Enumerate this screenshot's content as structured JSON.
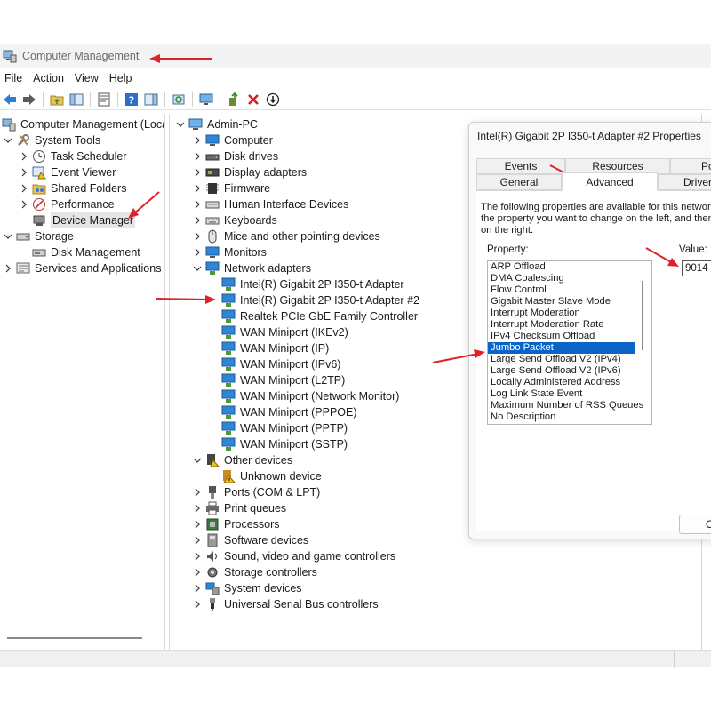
{
  "window": {
    "title": "Computer Management"
  },
  "menu": {
    "file": "File",
    "action": "Action",
    "view": "View",
    "help": "Help"
  },
  "toolbar": {
    "buttons": [
      "back-icon",
      "forward-icon",
      "up-folder-icon",
      "show-hide-tree-icon",
      "properties-icon",
      "help-icon",
      "action-pane-icon",
      "refresh-icon",
      "monitor-icon",
      "update-driver-icon",
      "uninstall-icon",
      "disable-icon"
    ]
  },
  "left_tree": {
    "root": "Computer Management (Local",
    "system_tools": "System Tools",
    "task_scheduler": "Task Scheduler",
    "event_viewer": "Event Viewer",
    "shared_folders": "Shared Folders",
    "performance": "Performance",
    "device_manager": "Device Manager",
    "storage": "Storage",
    "disk_management": "Disk Management",
    "services": "Services and Applications"
  },
  "device_tree": {
    "root": "Admin-PC",
    "categories": {
      "computer": "Computer",
      "disk_drives": "Disk drives",
      "display_adapters": "Display adapters",
      "firmware": "Firmware",
      "hid": "Human Interface Devices",
      "keyboards": "Keyboards",
      "mice": "Mice and other pointing devices",
      "monitors": "Monitors",
      "network_adapters": "Network adapters",
      "other_devices": "Other devices",
      "ports": "Ports (COM & LPT)",
      "print_queues": "Print queues",
      "processors": "Processors",
      "software_devices": "Software devices",
      "sound": "Sound, video and game controllers",
      "storage_controllers": "Storage controllers",
      "system_devices": "System devices",
      "usb": "Universal Serial Bus controllers"
    },
    "network_adapters": [
      "Intel(R) Gigabit 2P I350-t Adapter",
      "Intel(R) Gigabit 2P I350-t Adapter #2",
      "Realtek PCIe GbE Family Controller",
      "WAN Miniport (IKEv2)",
      "WAN Miniport (IP)",
      "WAN Miniport (IPv6)",
      "WAN Miniport (L2TP)",
      "WAN Miniport (Network Monitor)",
      "WAN Miniport (PPPOE)",
      "WAN Miniport (PPTP)",
      "WAN Miniport (SSTP)"
    ],
    "other_devices_children": [
      "Unknown device"
    ]
  },
  "dialog": {
    "title": "Intel(R) Gigabit 2P I350-t Adapter #2 Properties",
    "tabs": {
      "events": "Events",
      "resources": "Resources",
      "power": "Po",
      "general": "General",
      "advanced": "Advanced",
      "driver": "Driver"
    },
    "description": [
      "The following properties are available for this network",
      "the property you want to change on the left, and then",
      "on the right."
    ],
    "property_label": "Property:",
    "value_label": "Value:",
    "properties": [
      "ARP Offload",
      "DMA Coalescing",
      "Flow Control",
      "Gigabit Master Slave Mode",
      "Interrupt Moderation",
      "Interrupt Moderation Rate",
      "IPv4 Checksum Offload",
      "Jumbo Packet",
      "Large Send Offload V2 (IPv4)",
      "Large Send Offload V2 (IPv6)",
      "Locally Administered Address",
      "Log Link State Event",
      "Maximum Number of RSS Queues",
      "No Description"
    ],
    "selected_property": "Jumbo Packet",
    "value": "9014 I",
    "ok_label": "O"
  },
  "colors": {
    "selection": "#0a64c8",
    "annotation_arrow": "#e0202a",
    "folder_green": "#4a9a3b",
    "monitor_blue": "#2e86d6"
  }
}
